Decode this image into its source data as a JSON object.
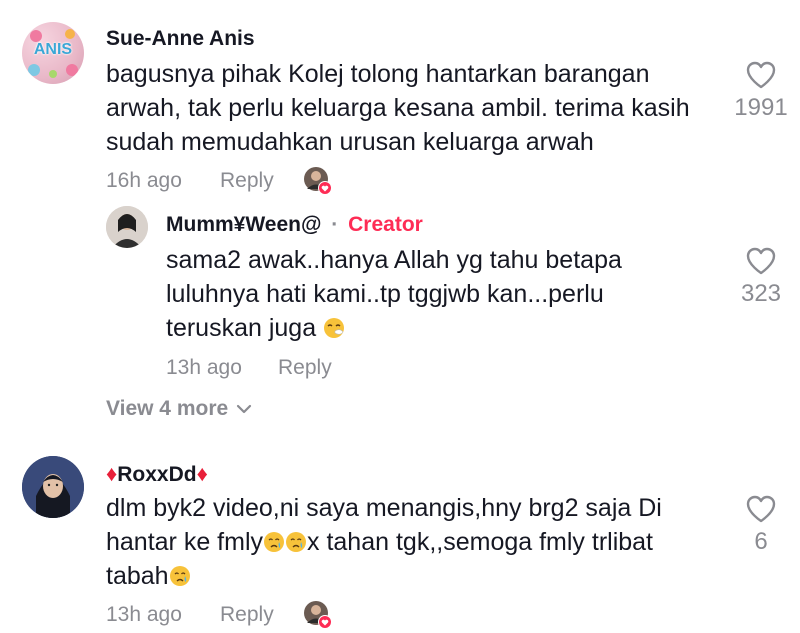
{
  "comments": [
    {
      "username": "Sue-Anne Anis",
      "avatar_text": "ANIS",
      "text": "bagusnya pihak Kolej tolong hantarkan barangan arwah, tak perlu keluarga kesana ambil. terima kasih sudah memudahkan urusan keluarga arwah",
      "time": "16h ago",
      "reply_label": "Reply",
      "like_count": "1991",
      "liked_by_creator": true
    },
    {
      "username": "Mumm¥Ween@",
      "separator": "·",
      "creator_label": "Creator",
      "text": "sama2 awak..hanya Allah yg tahu betapa luluhnya hati kami..tp tggjwb kan...perlu teruskan juga",
      "time": "13h ago",
      "reply_label": "Reply",
      "like_count": "323"
    },
    {
      "username": "RoxxDd",
      "text_line1": "dlm byk2 video,ni saya menangis,hny brg2 saja Di",
      "text_line2": "hantar ke fmly",
      "text_line2b": "x tahan tgk,,semoga fmly trlibat",
      "text_line3": "tabah",
      "time": "13h ago",
      "reply_label": "Reply",
      "like_count": "6",
      "liked_by_creator": true
    }
  ],
  "view_more_label": "View 4 more",
  "colors": {
    "accent": "#fe2c55",
    "muted": "#8a8b91",
    "text": "#161823"
  },
  "icons": {
    "like": "heart-outline-icon",
    "expand": "chevron-down-icon",
    "creator_like": "heart-badge-icon"
  }
}
